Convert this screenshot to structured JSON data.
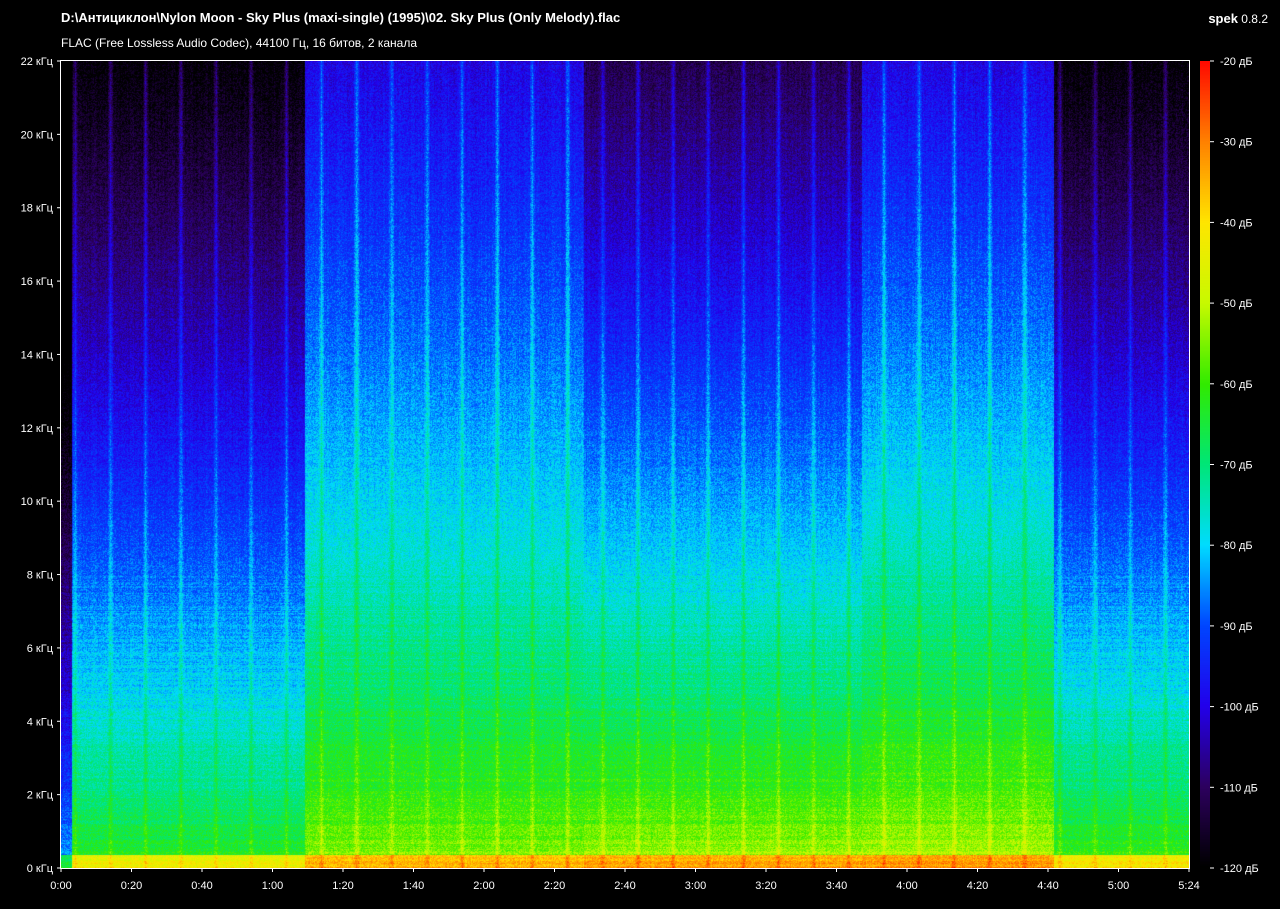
{
  "header": {
    "title": "D:\\Антициклон\\Nylon Moon - Sky Plus (maxi-single) (1995)\\02. Sky Plus (Only Melody).flac",
    "subtitle": "FLAC (Free Lossless Audio Codec), 44100 Гц, 16 битов, 2 канала",
    "app_name": "spek",
    "app_version": "0.8.2"
  },
  "chart_data": {
    "type": "heatmap",
    "title": "Spectrogram",
    "xlabel": "time",
    "ylabel": "frequency",
    "x_range_seconds": [
      0,
      324
    ],
    "y_range_khz": [
      0,
      22
    ],
    "x_ticks": [
      "0:00",
      "0:20",
      "0:40",
      "1:00",
      "1:20",
      "1:40",
      "2:00",
      "2:20",
      "2:40",
      "3:00",
      "3:20",
      "3:40",
      "4:00",
      "4:20",
      "4:40",
      "5:00",
      "5:24"
    ],
    "y_ticks": [
      "0 кГц",
      "2 кГц",
      "4 кГц",
      "6 кГц",
      "8 кГц",
      "10 кГц",
      "12 кГц",
      "14 кГц",
      "16 кГц",
      "18 кГц",
      "20 кГц",
      "22 кГц"
    ],
    "color_scale_db": [
      -120,
      -20
    ],
    "color_ticks": [
      "-20 дБ",
      "-30 дБ",
      "-40 дБ",
      "-50 дБ",
      "-60 дБ",
      "-70 дБ",
      "-80 дБ",
      "-90 дБ",
      "-100 дБ",
      "-110 дБ",
      "-120 дБ"
    ],
    "colors": {
      "low": "#000000",
      "mid": "#00ff00",
      "high": "#ff0000"
    }
  }
}
